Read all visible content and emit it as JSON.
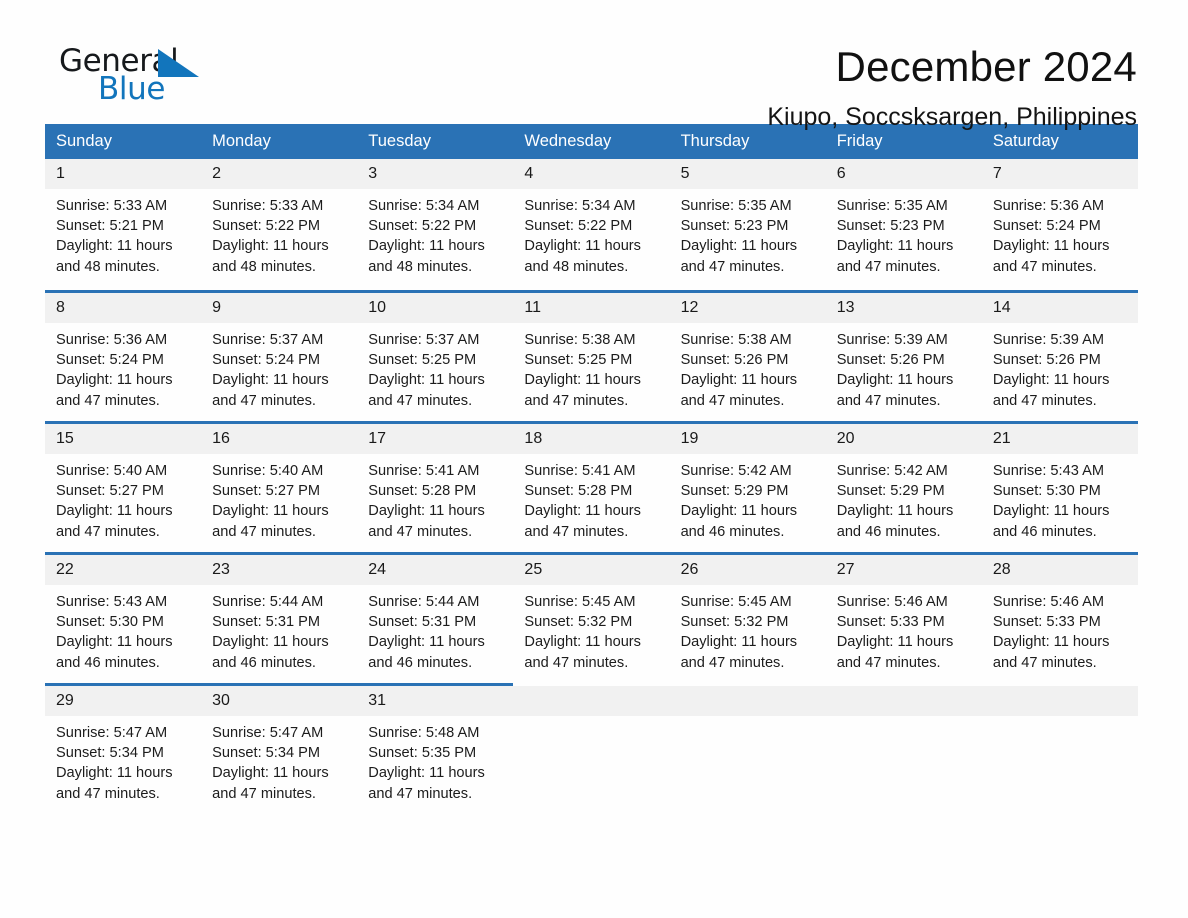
{
  "brand": {
    "name_top": "General",
    "name_bottom": "Blue",
    "triangle_icon": "triangle-icon",
    "accent_color": "#1275bc"
  },
  "header": {
    "title": "December 2024",
    "subtitle": "Kiupo, Soccsksargen, Philippines"
  },
  "colors": {
    "header_blue": "#2a72b5",
    "daynum_gray": "#f1f1f1",
    "text": "#1a1a1a"
  },
  "calendar": {
    "weekday_headers": [
      "Sunday",
      "Monday",
      "Tuesday",
      "Wednesday",
      "Thursday",
      "Friday",
      "Saturday"
    ],
    "weeks": [
      [
        {
          "day": "1",
          "info": "Sunrise: 5:33 AM\nSunset: 5:21 PM\nDaylight: 11 hours and 48 minutes."
        },
        {
          "day": "2",
          "info": "Sunrise: 5:33 AM\nSunset: 5:22 PM\nDaylight: 11 hours and 48 minutes."
        },
        {
          "day": "3",
          "info": "Sunrise: 5:34 AM\nSunset: 5:22 PM\nDaylight: 11 hours and 48 minutes."
        },
        {
          "day": "4",
          "info": "Sunrise: 5:34 AM\nSunset: 5:22 PM\nDaylight: 11 hours and 48 minutes."
        },
        {
          "day": "5",
          "info": "Sunrise: 5:35 AM\nSunset: 5:23 PM\nDaylight: 11 hours and 47 minutes."
        },
        {
          "day": "6",
          "info": "Sunrise: 5:35 AM\nSunset: 5:23 PM\nDaylight: 11 hours and 47 minutes."
        },
        {
          "day": "7",
          "info": "Sunrise: 5:36 AM\nSunset: 5:24 PM\nDaylight: 11 hours and 47 minutes."
        }
      ],
      [
        {
          "day": "8",
          "info": "Sunrise: 5:36 AM\nSunset: 5:24 PM\nDaylight: 11 hours and 47 minutes."
        },
        {
          "day": "9",
          "info": "Sunrise: 5:37 AM\nSunset: 5:24 PM\nDaylight: 11 hours and 47 minutes."
        },
        {
          "day": "10",
          "info": "Sunrise: 5:37 AM\nSunset: 5:25 PM\nDaylight: 11 hours and 47 minutes."
        },
        {
          "day": "11",
          "info": "Sunrise: 5:38 AM\nSunset: 5:25 PM\nDaylight: 11 hours and 47 minutes."
        },
        {
          "day": "12",
          "info": "Sunrise: 5:38 AM\nSunset: 5:26 PM\nDaylight: 11 hours and 47 minutes."
        },
        {
          "day": "13",
          "info": "Sunrise: 5:39 AM\nSunset: 5:26 PM\nDaylight: 11 hours and 47 minutes."
        },
        {
          "day": "14",
          "info": "Sunrise: 5:39 AM\nSunset: 5:26 PM\nDaylight: 11 hours and 47 minutes."
        }
      ],
      [
        {
          "day": "15",
          "info": "Sunrise: 5:40 AM\nSunset: 5:27 PM\nDaylight: 11 hours and 47 minutes."
        },
        {
          "day": "16",
          "info": "Sunrise: 5:40 AM\nSunset: 5:27 PM\nDaylight: 11 hours and 47 minutes."
        },
        {
          "day": "17",
          "info": "Sunrise: 5:41 AM\nSunset: 5:28 PM\nDaylight: 11 hours and 47 minutes."
        },
        {
          "day": "18",
          "info": "Sunrise: 5:41 AM\nSunset: 5:28 PM\nDaylight: 11 hours and 47 minutes."
        },
        {
          "day": "19",
          "info": "Sunrise: 5:42 AM\nSunset: 5:29 PM\nDaylight: 11 hours and 46 minutes."
        },
        {
          "day": "20",
          "info": "Sunrise: 5:42 AM\nSunset: 5:29 PM\nDaylight: 11 hours and 46 minutes."
        },
        {
          "day": "21",
          "info": "Sunrise: 5:43 AM\nSunset: 5:30 PM\nDaylight: 11 hours and 46 minutes."
        }
      ],
      [
        {
          "day": "22",
          "info": "Sunrise: 5:43 AM\nSunset: 5:30 PM\nDaylight: 11 hours and 46 minutes."
        },
        {
          "day": "23",
          "info": "Sunrise: 5:44 AM\nSunset: 5:31 PM\nDaylight: 11 hours and 46 minutes."
        },
        {
          "day": "24",
          "info": "Sunrise: 5:44 AM\nSunset: 5:31 PM\nDaylight: 11 hours and 46 minutes."
        },
        {
          "day": "25",
          "info": "Sunrise: 5:45 AM\nSunset: 5:32 PM\nDaylight: 11 hours and 47 minutes."
        },
        {
          "day": "26",
          "info": "Sunrise: 5:45 AM\nSunset: 5:32 PM\nDaylight: 11 hours and 47 minutes."
        },
        {
          "day": "27",
          "info": "Sunrise: 5:46 AM\nSunset: 5:33 PM\nDaylight: 11 hours and 47 minutes."
        },
        {
          "day": "28",
          "info": "Sunrise: 5:46 AM\nSunset: 5:33 PM\nDaylight: 11 hours and 47 minutes."
        }
      ],
      [
        {
          "day": "29",
          "info": "Sunrise: 5:47 AM\nSunset: 5:34 PM\nDaylight: 11 hours and 47 minutes."
        },
        {
          "day": "30",
          "info": "Sunrise: 5:47 AM\nSunset: 5:34 PM\nDaylight: 11 hours and 47 minutes."
        },
        {
          "day": "31",
          "info": "Sunrise: 5:48 AM\nSunset: 5:35 PM\nDaylight: 11 hours and 47 minutes."
        },
        {
          "day": "",
          "info": ""
        },
        {
          "day": "",
          "info": ""
        },
        {
          "day": "",
          "info": ""
        },
        {
          "day": "",
          "info": ""
        }
      ]
    ]
  }
}
